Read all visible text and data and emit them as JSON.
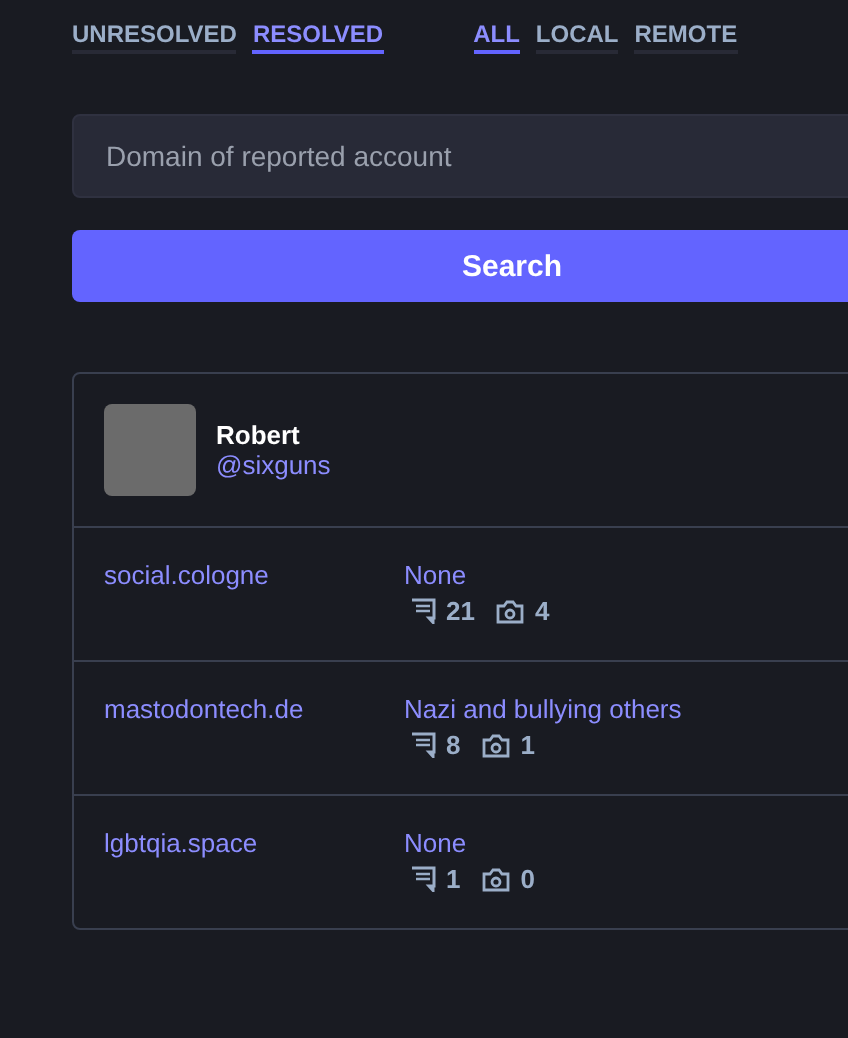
{
  "filters": [
    {
      "tabs": [
        {
          "label": "UNRESOLVED",
          "selected": false
        },
        {
          "label": "RESOLVED",
          "selected": true
        }
      ]
    },
    {
      "tabs": [
        {
          "label": "ALL",
          "selected": true
        },
        {
          "label": "LOCAL",
          "selected": false
        },
        {
          "label": "REMOTE",
          "selected": false
        }
      ]
    }
  ],
  "search": {
    "placeholder": "Domain of reported account"
  },
  "search_button": "Search",
  "account": {
    "display_name": "Robert",
    "handle": "@sixguns"
  },
  "reports": [
    {
      "domain": "social.cologne",
      "reason": "None",
      "comments": "21",
      "attachments": "4"
    },
    {
      "domain": "mastodontech.de",
      "reason": "Nazi and bullying others",
      "comments": "8",
      "attachments": "1"
    },
    {
      "domain": "lgbtqia.space",
      "reason": "None",
      "comments": "1",
      "attachments": "0"
    }
  ]
}
